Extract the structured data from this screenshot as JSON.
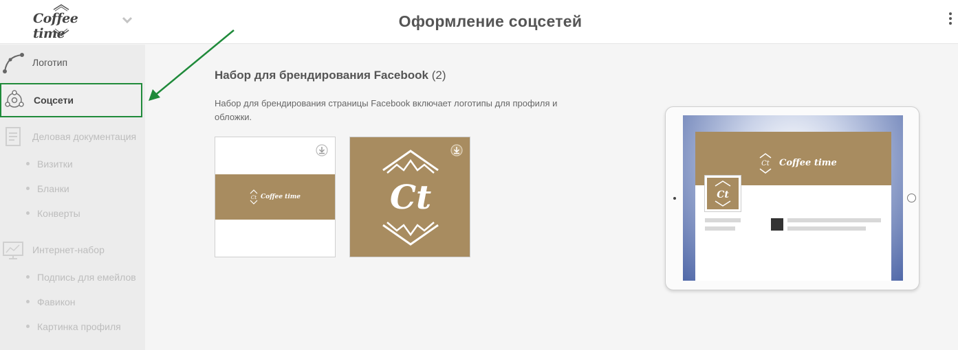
{
  "header": {
    "logo_text": "Coffee time",
    "title": "Оформление соцсетей"
  },
  "sidebar": {
    "items": [
      {
        "label": "Логотип",
        "icon": "vector-pen-icon"
      },
      {
        "label": "Соцсети",
        "icon": "social-network-icon",
        "active": true
      },
      {
        "label": "Деловая документация",
        "icon": "document-icon"
      },
      {
        "label": "Визитки"
      },
      {
        "label": "Бланки"
      },
      {
        "label": "Конверты"
      },
      {
        "label": "Интернет-набор",
        "icon": "monitor-icon"
      },
      {
        "label": "Подпись для емейлов"
      },
      {
        "label": "Фавикон"
      },
      {
        "label": "Картинка профиля"
      }
    ]
  },
  "content": {
    "section_title": "Набор для брендирования Facebook",
    "section_count": "(2)",
    "section_desc": "Набор для брендирования страницы Facebook включает логотипы для профиля и обложки.",
    "cover_logo_text": "Coffee time",
    "profile_monogram": "Ct"
  },
  "tablet": {
    "cover_text": "Coffee time",
    "avatar_monogram": "Ct"
  },
  "colors": {
    "brand": "#a88c60",
    "highlight": "#1f8a3a"
  }
}
